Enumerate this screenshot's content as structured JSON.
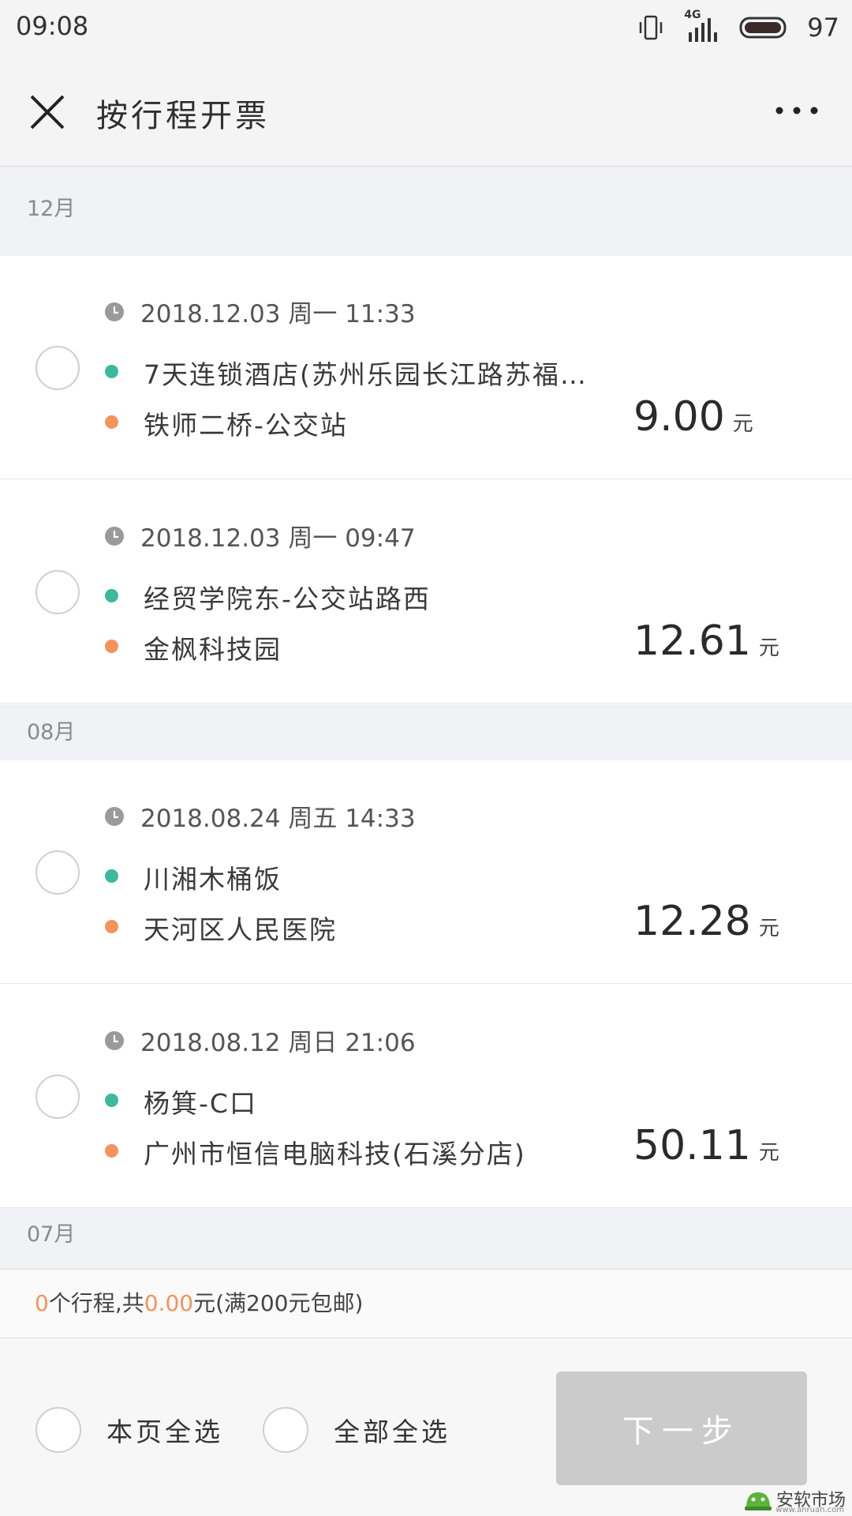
{
  "status_bar": {
    "time": "09:08",
    "network": "4G",
    "battery": "97"
  },
  "header": {
    "title": "按行程开票",
    "close_icon": "close-icon",
    "more_icon": "more-icon"
  },
  "groups": [
    {
      "month": "12月"
    },
    {
      "month": "08月"
    },
    {
      "month": "07月"
    }
  ],
  "trips": [
    {
      "datetime": "2018.12.03 周一 11:33",
      "from": "7天连锁酒店(苏州乐园长江路苏福…",
      "to": "铁师二桥-公交站",
      "amount": "9.00",
      "unit": "元"
    },
    {
      "datetime": "2018.12.03 周一 09:47",
      "from": "经贸学院东-公交站路西",
      "to": "金枫科技园",
      "amount": "12.61",
      "unit": "元"
    },
    {
      "datetime": "2018.08.24 周五 14:33",
      "from": "川湘木桶饭",
      "to": "天河区人民医院",
      "amount": "12.28",
      "unit": "元"
    },
    {
      "datetime": "2018.08.12 周日 21:06",
      "from": "杨箕-C口",
      "to": "广州市恒信电脑科技(石溪分店)",
      "amount": "50.11",
      "unit": "元"
    }
  ],
  "summary": {
    "count": "0",
    "text_trips": "个行程,共",
    "total": "0.00",
    "text_tail": "元(满200元包邮)"
  },
  "footer": {
    "select_page": "本页全选",
    "select_all": "全部全选",
    "next": "下一步"
  },
  "watermark": {
    "text": "安软市场",
    "url": "www.anruan.com"
  },
  "colors": {
    "from_dot": "#3bb99b",
    "to_dot": "#f4935a",
    "highlight": "#f4935a",
    "button_disabled": "#cbcbcb"
  }
}
